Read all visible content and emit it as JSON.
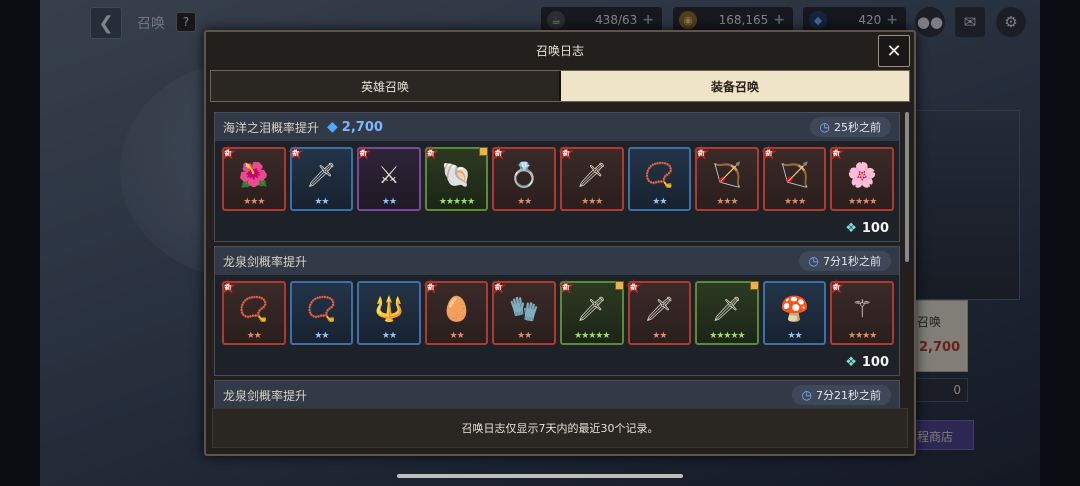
{
  "background": {
    "title": "召唤",
    "help_label": "?",
    "resources": [
      {
        "name": "stamina",
        "value": "438/63",
        "icon": "coffee-icon",
        "color": "#b9b9b9"
      },
      {
        "name": "gold",
        "value": "168,165",
        "icon": "coin-icon",
        "color": "#c9a34a"
      },
      {
        "name": "gems",
        "value": "420",
        "icon": "gem-icon",
        "color": "#4aa0ff"
      }
    ],
    "side_summon_label": "召唤",
    "side_summon_cost": "2,700",
    "side_count": "0",
    "side_shop_label": "程商店"
  },
  "modal": {
    "title": "召唤日志",
    "close_label": "✕",
    "tabs": [
      {
        "label": "英雄召唤",
        "active": false
      },
      {
        "label": "装备召唤",
        "active": true
      }
    ],
    "sections": [
      {
        "title": "海洋之泪概率提升",
        "cost": "2,700",
        "time": "25秒之前",
        "footer_value": "100",
        "items": [
          {
            "icon": "🌺",
            "rarity": "red",
            "stars": "★★★",
            "new": true
          },
          {
            "icon": "🗡",
            "rarity": "blue",
            "stars": "★★",
            "new": true
          },
          {
            "icon": "⚔",
            "rarity": "purple",
            "stars": "★★",
            "new": true
          },
          {
            "icon": "🐚",
            "rarity": "green",
            "stars": "★★★★★",
            "new": true,
            "corner": true
          },
          {
            "icon": "💍",
            "rarity": "red",
            "stars": "★★",
            "new": true
          },
          {
            "icon": "🗡",
            "rarity": "red",
            "stars": "★★★",
            "new": true
          },
          {
            "icon": "📿",
            "rarity": "blue",
            "stars": "★★",
            "new": false
          },
          {
            "icon": "🏹",
            "rarity": "red",
            "stars": "★★★",
            "new": true
          },
          {
            "icon": "🏹",
            "rarity": "red",
            "stars": "★★★",
            "new": true
          },
          {
            "icon": "🌸",
            "rarity": "red",
            "stars": "★★★★",
            "new": true
          }
        ]
      },
      {
        "title": "龙泉剑概率提升",
        "cost": "",
        "time": "7分1秒之前",
        "footer_value": "100",
        "items": [
          {
            "icon": "📿",
            "rarity": "red",
            "stars": "★★",
            "new": true
          },
          {
            "icon": "📿",
            "rarity": "blue",
            "stars": "★★",
            "new": false
          },
          {
            "icon": "🔱",
            "rarity": "blue",
            "stars": "★★",
            "new": false
          },
          {
            "icon": "🥚",
            "rarity": "red",
            "stars": "★★",
            "new": true
          },
          {
            "icon": "🧤",
            "rarity": "red",
            "stars": "★★",
            "new": true
          },
          {
            "icon": "🗡",
            "rarity": "green",
            "stars": "★★★★★",
            "new": true,
            "corner": true
          },
          {
            "icon": "🗡",
            "rarity": "red",
            "stars": "★★",
            "new": true
          },
          {
            "icon": "🗡",
            "rarity": "green",
            "stars": "★★★★★",
            "new": false,
            "corner": true
          },
          {
            "icon": "🍄",
            "rarity": "blue",
            "stars": "★★",
            "new": false
          },
          {
            "icon": "⚚",
            "rarity": "red",
            "stars": "★★★★",
            "new": true
          }
        ]
      },
      {
        "title": "龙泉剑概率提升",
        "cost": "",
        "time": "7分21秒之前",
        "footer_value": "",
        "items": []
      }
    ],
    "notice": "召唤日志仅显示7天内的最近30个记录。"
  }
}
